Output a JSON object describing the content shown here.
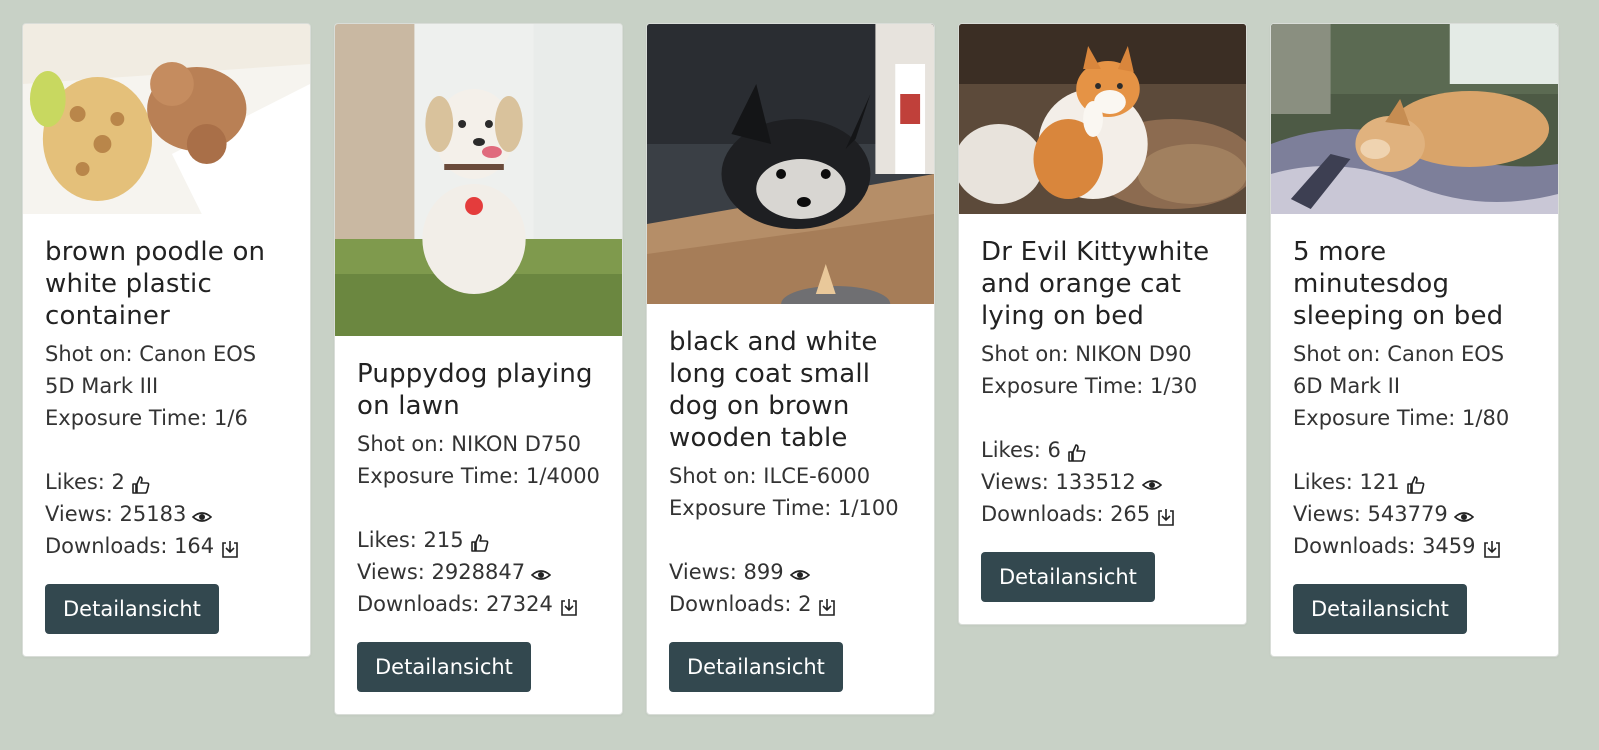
{
  "colors": {
    "page_background": "#c8d1c6",
    "card_background": "#ffffff",
    "button_background": "#33484f",
    "button_text": "#ffffff"
  },
  "labels": {
    "likes": "Likes:",
    "views": "Views:",
    "downloads": "Downloads:",
    "shot_on": "Shot on:",
    "exposure": "Exposure Time:"
  },
  "cards": [
    {
      "title": "brown poodle on white plastic container",
      "shot_on": "Shot on: Canon EOS 5D Mark III",
      "exposure": "Exposure Time: 1/6",
      "likes": "Likes: 2",
      "views": "Views: 25183",
      "downloads": "Downloads: 164",
      "button": "Detailansicht",
      "image_subject": "poodle-photo"
    },
    {
      "title": "Puppydog playing on lawn",
      "shot_on": "Shot on: NIKON D750",
      "exposure": "Exposure Time: 1/4000",
      "likes": "Likes: 215",
      "views": "Views: 2928847",
      "downloads": "Downloads: 27324",
      "button": "Detailansicht",
      "image_subject": "puppy-on-lawn-photo"
    },
    {
      "title": "black and white long coat small dog on brown wooden table",
      "shot_on": "Shot on: ILCE-6000",
      "exposure": "Exposure Time: 1/100",
      "views": "Views: 899",
      "downloads": "Downloads: 2",
      "button": "Detailansicht",
      "image_subject": "small-dog-table-photo"
    },
    {
      "title": "Dr Evil Kittywhite and orange cat lying on bed",
      "shot_on": "Shot on: NIKON D90",
      "exposure": "Exposure Time: 1/30",
      "likes": "Likes: 6",
      "views": "Views: 133512",
      "downloads": "Downloads: 265",
      "button": "Detailansicht",
      "image_subject": "cat-on-bed-photo"
    },
    {
      "title": "5 more minutesdog sleeping on bed",
      "shot_on": "Shot on: Canon EOS 6D Mark II",
      "exposure": "Exposure Time: 1/80",
      "likes": "Likes: 121",
      "views": "Views: 543779",
      "downloads": "Downloads: 3459",
      "button": "Detailansicht",
      "image_subject": "sleeping-dog-photo"
    }
  ],
  "icons": {
    "likes": "thumbs-up-icon",
    "views": "eye-icon",
    "downloads": "download-icon"
  }
}
